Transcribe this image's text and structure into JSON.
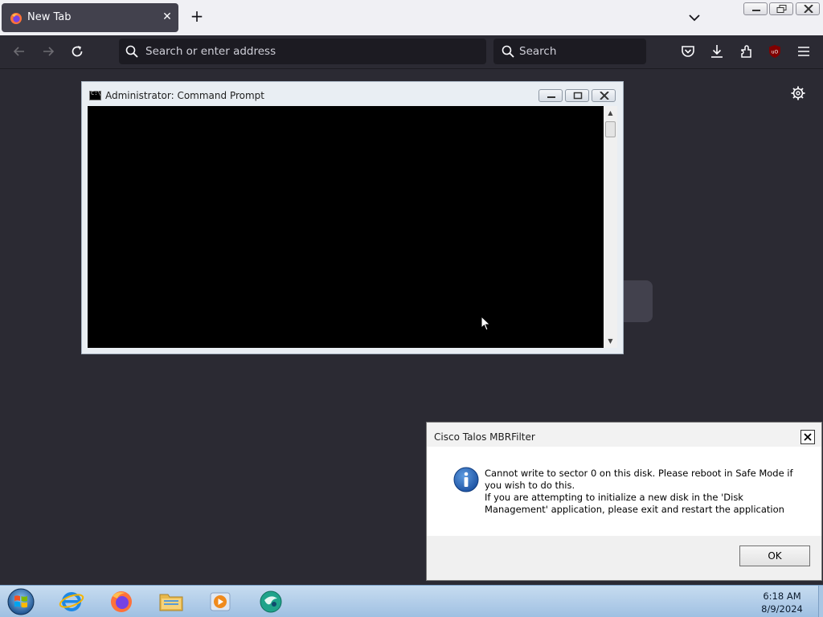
{
  "browser": {
    "tab": {
      "title": "New Tab",
      "close_label": "✕"
    },
    "new_tab_label": "+",
    "address_bar": {
      "placeholder": "Search or enter address"
    },
    "search_bar": {
      "placeholder": "Search"
    },
    "icons": [
      "back-arrow-icon",
      "forward-arrow-icon",
      "reload-icon",
      "pocket-icon",
      "download-icon",
      "extensions-icon",
      "ublock-icon",
      "hamburger-menu-icon",
      "settings-gear-icon"
    ]
  },
  "cmd_window": {
    "title": "Administrator:  Command Prompt",
    "icon_text": "C:\\",
    "scroll_up": "▲",
    "scroll_down": "▼"
  },
  "dialog": {
    "title": "Cisco Talos MBRFilter",
    "message_line1": "Cannot write to sector 0 on this disk. Please reboot in Safe Mode if you wish to do this.",
    "message_line2": "If you are attempting to initialize a new disk in the 'Disk Management' application, please exit and restart the application",
    "ok_label": "OK"
  },
  "taskbar": {
    "apps": [
      "internet-explorer-icon",
      "firefox-icon",
      "file-explorer-icon",
      "media-player-icon",
      "maps-app-icon"
    ],
    "time": "6:18 AM",
    "date": "8/9/2024"
  },
  "colors": {
    "browser_bg": "#2b2a33",
    "tab_active": "#42414d",
    "dialog_info_blue": "#1a5fb4"
  }
}
